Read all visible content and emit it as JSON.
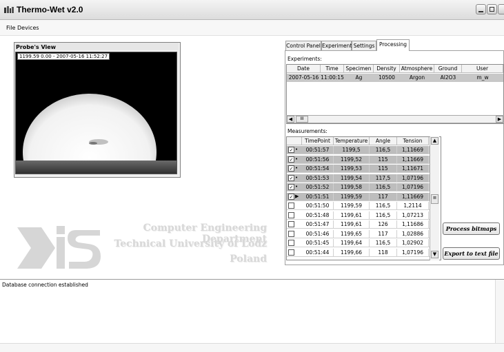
{
  "window": {
    "title": "Thermo-Wet v2.0"
  },
  "menu": {
    "file": "File",
    "devices": "Devices"
  },
  "probe": {
    "panel_title": "Probe's View",
    "caption": "1199.59 0.00 - 2007-05-16 11:52:27"
  },
  "logo": {
    "line1": "Computer Engineering Department",
    "line2": "Technical University of Lodz",
    "line3": "Poland"
  },
  "tabs": {
    "control_panel": "Control Panel",
    "experiment": "Experiment",
    "settings": "Settings",
    "processing": "Processing"
  },
  "experiments": {
    "label": "Experiments:",
    "headers": [
      "Date",
      "Time",
      "Specimen",
      "Density",
      "Atmosphere",
      "Ground",
      "User"
    ],
    "row": [
      "2007-05-16",
      "11:00:15",
      "Ag",
      "10500",
      "Argon",
      "Al2O3",
      "m_w"
    ],
    "scroll_thumb": "III"
  },
  "measurements": {
    "label": "Measurements:",
    "headers": [
      "TimePoint",
      "Temperature",
      "Angle",
      "Tension"
    ],
    "rows": [
      {
        "time": "00:51:57",
        "temp": "1199,5",
        "angle": "116,5",
        "tension": "1,11669",
        "checked": true,
        "mark": "•"
      },
      {
        "time": "00:51:56",
        "temp": "1199,52",
        "angle": "115",
        "tension": "1,11669",
        "checked": true,
        "mark": "•"
      },
      {
        "time": "00:51:54",
        "temp": "1199,53",
        "angle": "115",
        "tension": "1,11671",
        "checked": true,
        "mark": "•"
      },
      {
        "time": "00:51:53",
        "temp": "1199,54",
        "angle": "117,5",
        "tension": "1,07196",
        "checked": true,
        "mark": "•"
      },
      {
        "time": "00:51:52",
        "temp": "1199,58",
        "angle": "116,5",
        "tension": "1,07196",
        "checked": true,
        "mark": "•"
      },
      {
        "time": "00:51:51",
        "temp": "1199,59",
        "angle": "117",
        "tension": "1,11669",
        "checked": true,
        "mark": "▶"
      },
      {
        "time": "00:51:50",
        "temp": "1199,59",
        "angle": "116,5",
        "tension": "1,2114",
        "checked": false,
        "mark": ""
      },
      {
        "time": "00:51:48",
        "temp": "1199,61",
        "angle": "116,5",
        "tension": "1,07213",
        "checked": false,
        "mark": ""
      },
      {
        "time": "00:51:47",
        "temp": "1199,61",
        "angle": "126",
        "tension": "1,11686",
        "checked": false,
        "mark": ""
      },
      {
        "time": "00:51:46",
        "temp": "1199,65",
        "angle": "117",
        "tension": "1,02886",
        "checked": false,
        "mark": ""
      },
      {
        "time": "00:51:45",
        "temp": "1199,64",
        "angle": "116,5",
        "tension": "1,02902",
        "checked": false,
        "mark": ""
      },
      {
        "time": "00:51:44",
        "temp": "1199,66",
        "angle": "118",
        "tension": "1,07196",
        "checked": false,
        "mark": ""
      }
    ]
  },
  "actions": {
    "process": "Process bitmaps",
    "export": "Export to text file"
  },
  "log": {
    "text": "Database connection established"
  },
  "colors": {
    "selected_row": "#bdbdbd",
    "panel_bg": "#f0f0f0"
  }
}
